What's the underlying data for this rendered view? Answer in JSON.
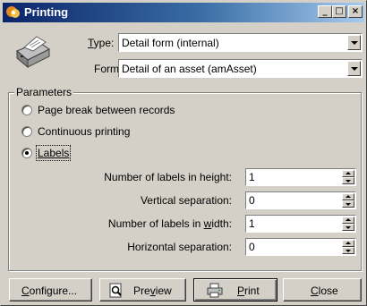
{
  "window": {
    "title": "Printing",
    "controls": {
      "minimize": "_",
      "maximize": "□",
      "close": "×"
    }
  },
  "icons": {
    "app": "app-logo-icon",
    "printer": "printer-icon",
    "preview": "preview-icon",
    "print": "print-icon"
  },
  "type_field": {
    "label_pre": "",
    "label_u": "T",
    "label_post": "ype:",
    "value": "Detail form (internal)"
  },
  "form_field": {
    "label": "Form:",
    "value": "Detail of an asset (amAsset)"
  },
  "parameters": {
    "title": "Parameters",
    "options": [
      {
        "label": "Page break between records",
        "selected": false
      },
      {
        "label": "Continuous printing",
        "selected": false
      },
      {
        "label": "Labels",
        "selected": true
      }
    ],
    "fields": [
      {
        "label_pre": "Number of labels in ",
        "label_u": "",
        "label_post": "height:",
        "value": "1"
      },
      {
        "label_pre": "Vertical separation:",
        "label_u": "",
        "label_post": "",
        "value": "0"
      },
      {
        "label_pre": "Number of labels in ",
        "label_u": "w",
        "label_post": "idth:",
        "value": "1"
      },
      {
        "label_pre": "Horizontal separation:",
        "label_u": "",
        "label_post": "",
        "value": "0"
      }
    ]
  },
  "buttons": {
    "configure": {
      "pre": "",
      "u": "C",
      "post": "onfigure..."
    },
    "preview": {
      "pre": "Pre",
      "u": "v",
      "post": "iew"
    },
    "print": {
      "pre": "",
      "u": "P",
      "post": "rint"
    },
    "close": {
      "pre": "",
      "u": "C",
      "post": "lose"
    }
  },
  "colors": {
    "face": "#d4d0c8",
    "title_start": "#0a246a",
    "title_end": "#a6caf0"
  }
}
